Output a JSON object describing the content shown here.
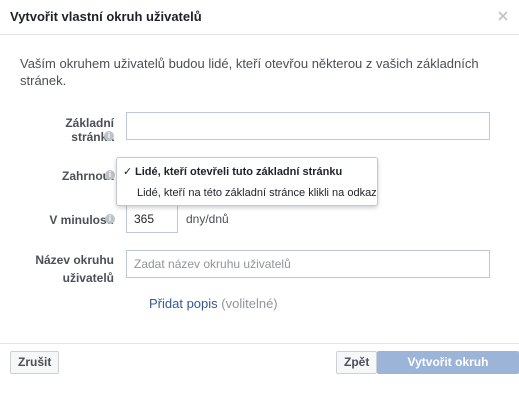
{
  "dialog": {
    "title": "Vytvořit vlastní okruh uživatelů",
    "close_label": "×"
  },
  "intro": "Vaším okruhem uživatelů budou lidé, kteří otevřou některou z vašich základních stránek.",
  "form": {
    "base_page_label": "Základní stránka",
    "base_page_value": "",
    "include_label": "Zahrnout",
    "include_options": [
      {
        "label": "Lidé, kteří otevřeli tuto základní stránku",
        "selected": true
      },
      {
        "label": "Lidé, kteří na této základní stránce klikli na odkaz",
        "selected": false
      }
    ],
    "check_mark": "✓",
    "lookback_label": "V minulosti",
    "lookback_value": "365",
    "lookback_unit": "dny/dnů",
    "name_label_line1": "Název okruhu",
    "name_label_line2": "uživatelů",
    "name_placeholder": "Zadat název okruhu uživatelů",
    "add_description_link": "Přidat popis",
    "add_description_optional": "(volitelné)"
  },
  "footer": {
    "cancel_label": "Zrušit",
    "back_label": "Zpět",
    "create_label": "Vytvořit okruh uživatelů"
  },
  "colors": {
    "link": "#365899",
    "primary_button_disabled": "#9cb4d8",
    "border": "#bdc7d8"
  }
}
